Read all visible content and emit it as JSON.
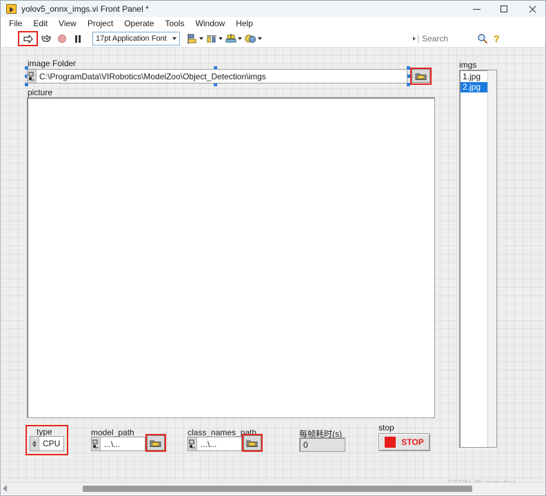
{
  "window": {
    "title": "yolov5_onnx_imgs.vi Front Panel *",
    "icon_name": "labview-vi-icon",
    "minimize_label": "Minimize",
    "maximize_label": "Maximize",
    "close_label": "Close"
  },
  "menubar": {
    "items": [
      {
        "label": "File"
      },
      {
        "label": "Edit"
      },
      {
        "label": "View"
      },
      {
        "label": "Project"
      },
      {
        "label": "Operate"
      },
      {
        "label": "Tools"
      },
      {
        "label": "Window"
      },
      {
        "label": "Help"
      }
    ]
  },
  "toolbar": {
    "run_icon": "run-arrow-icon",
    "run_continuously_icon": "run-continuously-icon",
    "abort_icon": "abort-execution-icon",
    "pause_icon": "pause-icon",
    "font_selector_label": "17pt Application Font",
    "align_objects_icon": "align-objects-icon",
    "distribute_objects_icon": "distribute-objects-icon",
    "resize_objects_icon": "resize-objects-icon",
    "reorder_icon": "reorder-objects-icon",
    "search_placeholder": "Search",
    "search_value": "",
    "search_icon": "search-magnifier-icon",
    "help_icon": "context-help-question-icon",
    "connector_pane_icon": "connector-pane-icon",
    "vi_icon": "vi-thumbnail-icon"
  },
  "panel": {
    "image_folder": {
      "label": "image Folder",
      "value": "C:\\ProgramData\\VIRobotics\\ModelZoo\\Object_Detection\\imgs",
      "browse_icon": "folder-browse-icon",
      "path_glyph_icon": "path-control-icon"
    },
    "picture": {
      "label": "picture"
    },
    "imgs": {
      "label": "imgs",
      "items": [
        {
          "name": "1.jpg",
          "selected": false
        },
        {
          "name": "2.jpg",
          "selected": true
        }
      ]
    },
    "type": {
      "label": "type",
      "value": "CPU",
      "increment_icon": "increment-arrow-icon",
      "decrement_icon": "decrement-arrow-icon"
    },
    "model_path": {
      "label": "model_path",
      "value": "...\\...",
      "browse_icon": "folder-browse-icon",
      "path_glyph_icon": "path-control-icon"
    },
    "class_names_path": {
      "label": "class_names_path",
      "value": "...\\...",
      "browse_icon": "folder-browse-icon",
      "path_glyph_icon": "path-control-icon"
    },
    "frame_time": {
      "label": "每帧耗时(s)",
      "value": "0"
    },
    "stop": {
      "label": "stop",
      "button_text": "STOP",
      "indicator_icon": "stop-square-icon"
    }
  },
  "watermark": {
    "text": "CSDN @virobotics"
  },
  "scrollbar": {
    "name": "horizontal-scrollbar"
  },
  "colors": {
    "highlight_red": "#e8261c",
    "selection_blue": "#1a7ae0",
    "stop_red": "#e81b1b",
    "panel_bg": "#eeeeee"
  }
}
